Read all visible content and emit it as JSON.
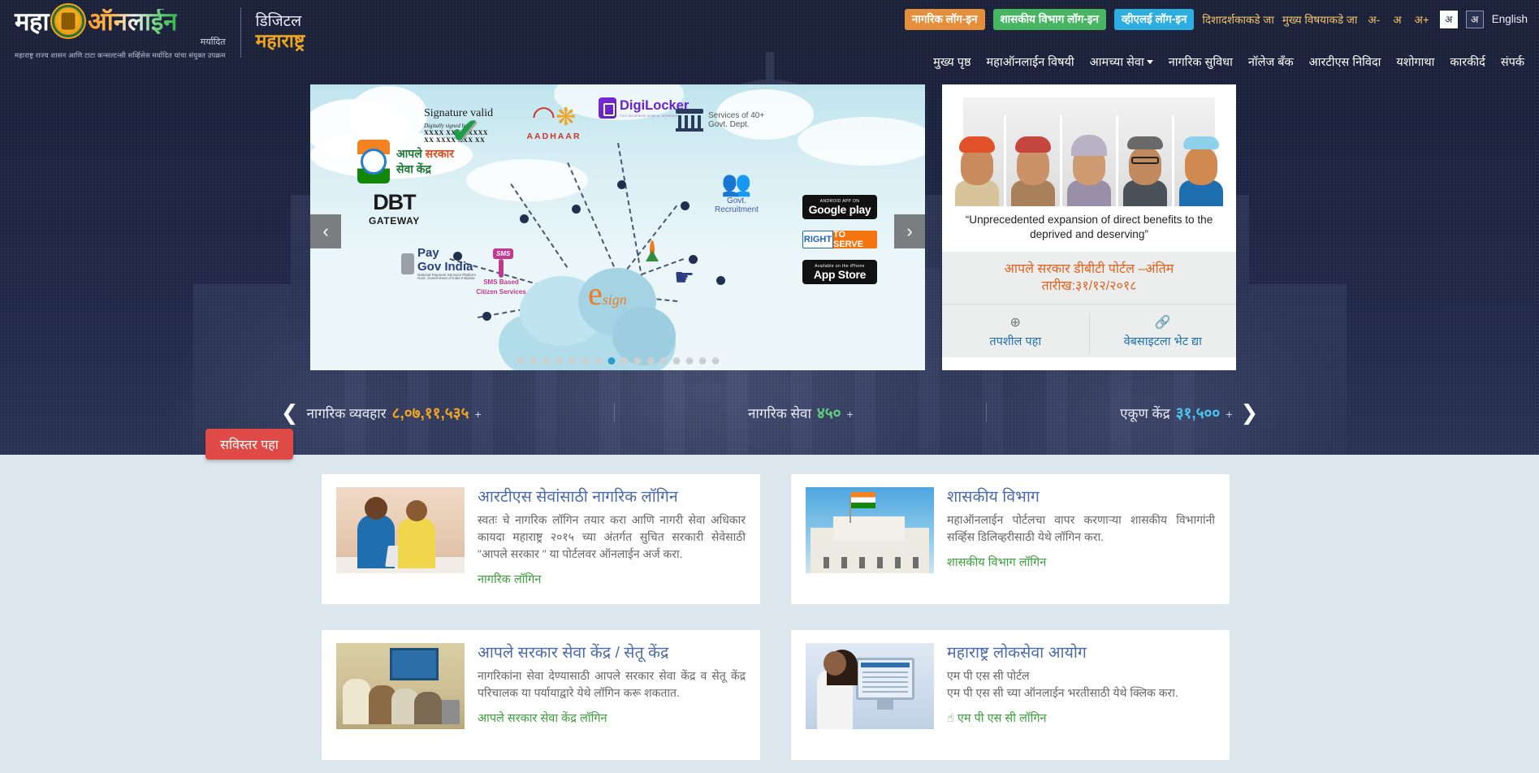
{
  "brand": {
    "maha": "महा",
    "online": "ऑनलाईन",
    "maryadit": "मर्यादित",
    "tagline": "महाराष्ट्र राज्य शासन आणि टाटा कन्सल्टन्सी सर्व्हिसेस मर्यादित यांचा संयुक्त उपक्रम",
    "digital_line1": "डिजिटल",
    "digital_line2": "महाराष्ट्र"
  },
  "topbar": {
    "citizen_login": "नागरिक लॉग-इन",
    "dept_login": "शासकीय विभाग लॉग-इन",
    "vle_login": "व्हीएलई लॉग-इन",
    "skip_to_nav": "दिशादर्शकाकडे जा",
    "skip_to_content": "मुख्य विषयाकडे जा",
    "font_decrease": "अ-",
    "font_normal": "अ",
    "font_increase": "अ+",
    "lang_marathi": "अ",
    "lang_alt": "अ",
    "lang_english": "English"
  },
  "nav": {
    "items": [
      {
        "label": "मुख्य पृष्ठ",
        "has_caret": false
      },
      {
        "label": "महाऑनलाईन विषयी",
        "has_caret": false
      },
      {
        "label": "आमच्या सेवा",
        "has_caret": true
      },
      {
        "label": "नागरिक सुविधा",
        "has_caret": false
      },
      {
        "label": "नॉलेज बँक",
        "has_caret": false
      },
      {
        "label": "आरटीएस निविदा",
        "has_caret": false
      },
      {
        "label": "यशोगाथा",
        "has_caret": false
      },
      {
        "label": "कारकीर्द",
        "has_caret": false
      },
      {
        "label": "संपर्क",
        "has_caret": false
      }
    ]
  },
  "carousel": {
    "prev": "‹",
    "next": "›",
    "total_dots": 16,
    "active_dot": 7,
    "signature": {
      "title": "Signature valid",
      "signed_by": "Digitally signed by",
      "line1": "XXXX XX XXXXXX",
      "line2": "XX XXXX XXX XX",
      "check": "✔"
    },
    "aadhaar_label": "AADHAAR",
    "digilocker_label": "DigiLocker",
    "digilocker_sub": "Your documents anytime, anywhere",
    "govt_dept_label_line1": "Services of 40+",
    "govt_dept_label_line2": "Govt. Dept.",
    "recruitment_label": "Govt. Recruitment",
    "aaple_line1_a": "आपले ",
    "aaple_line1_b": "सरकार",
    "aaple_line2": "सेवा केंद्र",
    "dbt_main": "DBT",
    "dbt_sub": "GATEWAY",
    "paygov_line1": "Pay",
    "paygov_line2": "Gov India",
    "paygov_sub": "National Payment Services Platform",
    "paygov_sub2": "Govt. Government of India Initiative",
    "sms_bubble": "SMS",
    "sms_line1": "SMS Based",
    "sms_line2": "Citizen Services",
    "esign_e": "e",
    "esign_sign": "sign",
    "google_play_top": "ANDROID APP ON",
    "google_play_main": "Google play",
    "right_to_serve_a": "RIGHT",
    "right_to_serve_b": "TO SERVE",
    "app_store_top": "Available on the iPhone",
    "app_store_main": "App Store"
  },
  "sidepanel": {
    "prev": "‹",
    "next": "›",
    "quote": "“Unprecedented expansion of direct benefits to the deprived and deserving”",
    "banner_line1": "आपले सरकार डीबीटी पोर्टल –अंतिम",
    "banner_line2": "तारीख:३१/१२/२०१८",
    "action_details_icon": "⊕",
    "action_details": "तपशील पहा",
    "action_website_icon": "🔗",
    "action_website": "वेबसाइटला भेट द्या"
  },
  "stats": {
    "prev": "❮",
    "next": "❯",
    "items": [
      {
        "label": "नागरिक व्यवहार",
        "value": "८,०७,११,५३५",
        "plus": "+",
        "color": "#f0a51e"
      },
      {
        "label": "नागरिक सेवा",
        "value": "४५०",
        "plus": "+",
        "color": "#5fd07e"
      },
      {
        "label": "एकूण केंद्र",
        "value": "३१,५००",
        "plus": "+",
        "color": "#46c8ee"
      }
    ]
  },
  "cta": {
    "detail_button": "सविस्तर पहा"
  },
  "cards": [
    {
      "title": "आरटीएस सेवांसाठी नागरिक लॉगिन",
      "desc": "स्वतः चे नागरिक लॉगिन तयार करा आणि नागरी सेवा अधिकार कायदा महाराष्ट्र २०१५ च्या अंतर्गत सुचित सरकारी सेवेसाठी \"आपले सरकार \" या पोर्टलवर ऑनलाईन अर्ज करा.",
      "link": "नागरिक लॉगिन",
      "has_hand_icon": false,
      "thumb": "th1"
    },
    {
      "title": "शासकीय विभाग",
      "desc": "महाऑनलाईन पोर्टलचा वापर करणाऱ्या शासकीय विभागांनी सर्व्हिस डिलिव्हरीसाठी येथे लॉगिन करा.",
      "link": "शासकीय विभाग लॉगिन",
      "has_hand_icon": false,
      "thumb": "th2"
    },
    {
      "title": "आपले सरकार सेवा केंद्र / सेतू केंद्र",
      "desc": "नागरिकांना सेवा देण्यासाठी आपले सरकार सेवा केंद्र व सेतू केंद्र परिचालक या पर्यायाद्वारे येथे लॉगिन करू शकतात.",
      "link": "आपले सरकार सेवा केंद्र लॉगिन",
      "has_hand_icon": false,
      "thumb": "th3"
    },
    {
      "title": "महाराष्ट्र लोकसेवा आयोग",
      "desc": "एम पी एस सी पोर्टल\nएम पी एस सी च्या ऑनलाईन भरतीसाठी येथे क्लिक करा.",
      "link": "एम पी एस सी लॉगिन",
      "has_hand_icon": true,
      "hand_icon": "☝",
      "thumb": "th4"
    }
  ],
  "colors": {
    "citizen_login": "#e58f3c",
    "dept_login": "#47b562",
    "vle_login": "#2eaee0",
    "cta_red": "#e04a46",
    "card_title": "#4b6ca8",
    "card_link": "#3a9f3a",
    "banner_orange": "#e2621f"
  }
}
